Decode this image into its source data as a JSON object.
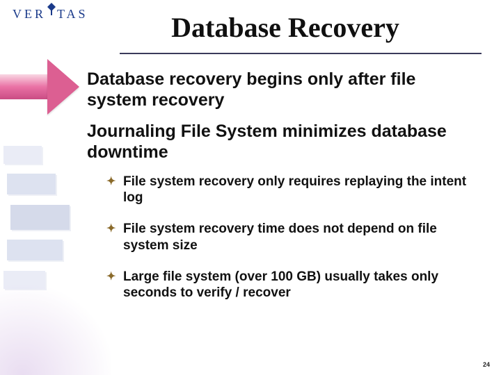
{
  "brand": {
    "logo_text_pre": "VER",
    "logo_text_post": "TAS"
  },
  "title": "Database Recovery",
  "leads": [
    "Database recovery begins only after file system recovery",
    "Journaling File System minimizes database downtime"
  ],
  "subs": [
    "File system recovery only requires replaying the intent log",
    "File system recovery time does not depend on file system size",
    "Large file system (over 100 GB) usually takes only seconds to verify / recover"
  ],
  "slide_number": "24",
  "colors": {
    "brand": "#1a3a8a",
    "rule": "#3a3a5a",
    "bullet": "#8a6a2a"
  }
}
